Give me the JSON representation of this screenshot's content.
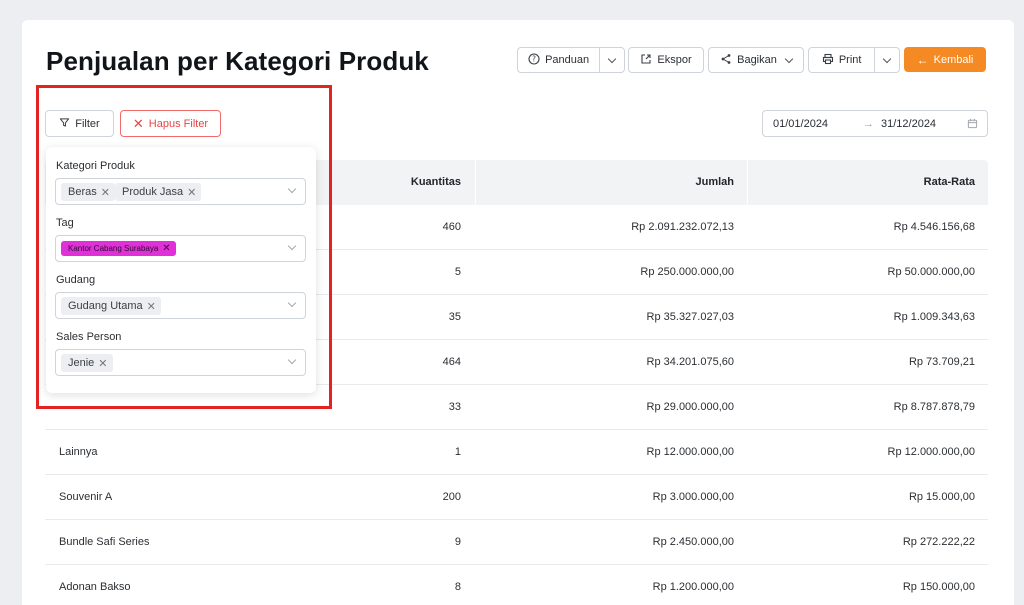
{
  "page": {
    "title": "Penjualan per Kategori Produk"
  },
  "toolbar": {
    "guide_label": "Panduan",
    "export_label": "Ekspor",
    "share_label": "Bagikan",
    "print_label": "Print",
    "back_label": "Kembali"
  },
  "filters": {
    "filter_label": "Filter",
    "clear_label": "Hapus Filter",
    "date_start": "01/01/2024",
    "date_end": "31/12/2024"
  },
  "panel": {
    "category_label": "Kategori Produk",
    "category_tags": [
      "Beras",
      "Produk Jasa"
    ],
    "tag_label": "Tag",
    "tag_tags": [
      "Kantor Cabang Surabaya"
    ],
    "warehouse_label": "Gudang",
    "warehouse_tags": [
      "Gudang Utama"
    ],
    "sales_label": "Sales Person",
    "sales_tags": [
      "Jenie"
    ]
  },
  "table": {
    "headers": {
      "qty": "Kuantitas",
      "sum": "Jumlah",
      "avg": "Rata-Rata"
    },
    "rows": [
      {
        "name": "",
        "qty": "460",
        "sum": "Rp 2.091.232.072,13",
        "avg": "Rp 4.546.156,68"
      },
      {
        "name": "",
        "qty": "5",
        "sum": "Rp 250.000.000,00",
        "avg": "Rp 50.000.000,00"
      },
      {
        "name": "",
        "qty": "35",
        "sum": "Rp 35.327.027,03",
        "avg": "Rp 1.009.343,63"
      },
      {
        "name": "",
        "qty": "464",
        "sum": "Rp 34.201.075,60",
        "avg": "Rp 73.709,21"
      },
      {
        "name": "",
        "qty": "33",
        "sum": "Rp 29.000.000,00",
        "avg": "Rp 8.787.878,79"
      },
      {
        "name": "Lainnya",
        "qty": "1",
        "sum": "Rp 12.000.000,00",
        "avg": "Rp 12.000.000,00"
      },
      {
        "name": "Souvenir A",
        "qty": "200",
        "sum": "Rp 3.000.000,00",
        "avg": "Rp 15.000,00"
      },
      {
        "name": "Bundle Safi Series",
        "qty": "9",
        "sum": "Rp 2.450.000,00",
        "avg": "Rp 272.222,22"
      },
      {
        "name": "Adonan Bakso",
        "qty": "8",
        "sum": "Rp 1.200.000,00",
        "avg": "Rp 150.000,00"
      }
    ]
  },
  "colors": {
    "accent": "#f58a25",
    "danger": "#e84444",
    "tag_magenta": "#e030d8",
    "highlight": "#e32222"
  },
  "icons": {
    "guide": "question-circle-icon",
    "export": "export-icon",
    "share": "share-icon",
    "print": "printer-icon",
    "back": "arrow-left-icon",
    "filter": "funnel-icon",
    "clear": "close-icon",
    "calendar": "calendar-icon"
  }
}
